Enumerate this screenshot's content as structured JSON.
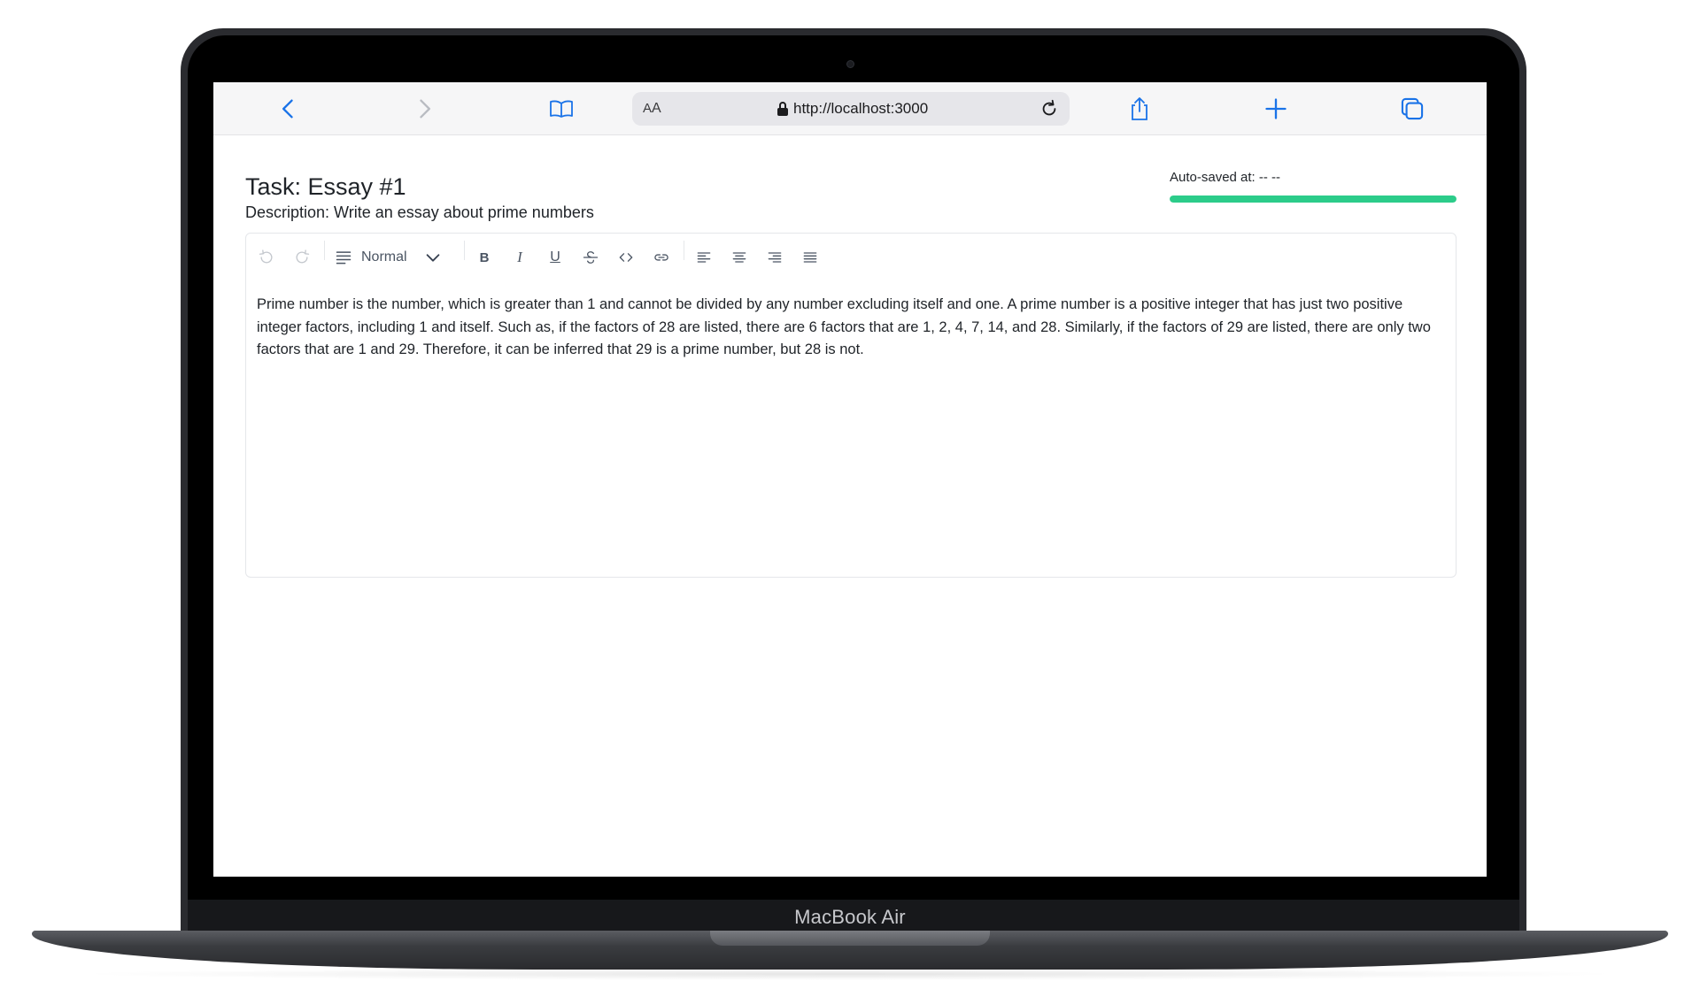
{
  "device": {
    "label": "MacBook Air"
  },
  "browser": {
    "text_size_label_small": "A",
    "text_size_label_big": "A",
    "url": "http://localhost:3000",
    "icons": [
      "chevron-left-icon",
      "chevron-right-icon",
      "book-icon",
      "lock-icon",
      "reload-icon",
      "share-icon",
      "plus-icon",
      "tabs-icon"
    ]
  },
  "task": {
    "title": "Task: Essay #1",
    "description": "Description: Write an essay about prime numbers"
  },
  "autosave": {
    "label": "Auto-saved at: -- --",
    "progress": 1.0,
    "color": "#2ccc8a"
  },
  "editor": {
    "block_type": "Normal",
    "toolbar_icons": [
      "undo-icon",
      "redo-icon",
      "paragraph-icon",
      "chevron-down-icon",
      "bold-icon",
      "italic-icon",
      "underline-icon",
      "strikethrough-icon",
      "code-icon",
      "link-icon",
      "align-left-icon",
      "align-center-icon",
      "align-right-icon",
      "align-justify-icon"
    ],
    "content": "Prime number is the number, which is greater than 1 and cannot be divided by any number excluding itself and one. A prime number is a positive integer that has just two positive integer factors, including 1 and itself. Such as, if the factors of 28 are listed, there are 6 factors that are 1, 2, 4, 7, 14, and 28. Similarly, if the factors of 29 are listed, there are only two factors that are 1 and 29. Therefore, it can be inferred that 29 is a prime number, but 28 is not."
  }
}
